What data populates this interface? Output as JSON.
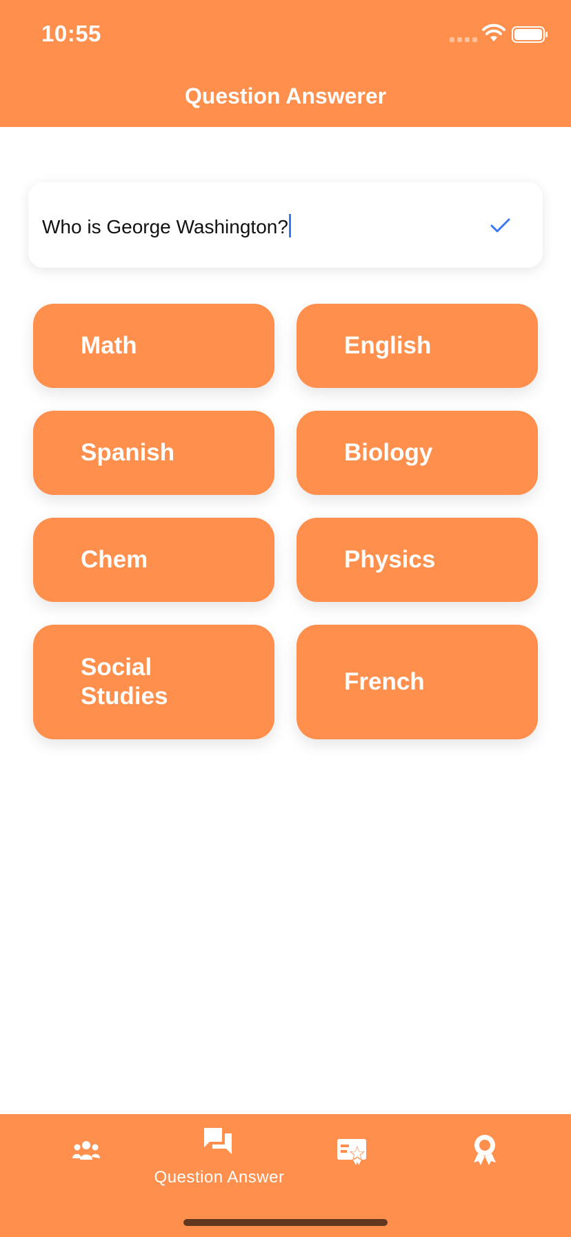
{
  "status_bar": {
    "time": "10:55"
  },
  "header": {
    "title": "Question Answerer"
  },
  "question_input": {
    "value": "Who is George Washington?"
  },
  "subjects": [
    {
      "label": "Math"
    },
    {
      "label": "English"
    },
    {
      "label": "Spanish"
    },
    {
      "label": "Biology"
    },
    {
      "label": "Chem"
    },
    {
      "label": "Physics"
    },
    {
      "label": "Social\nStudies"
    },
    {
      "label": "French"
    }
  ],
  "tab_bar": {
    "tabs": [
      {
        "icon": "group-icon",
        "label": ""
      },
      {
        "icon": "chat-bubbles-icon",
        "label": "Question Answer",
        "active": true
      },
      {
        "icon": "flashcard-star-icon",
        "label": ""
      },
      {
        "icon": "award-ribbon-icon",
        "label": ""
      }
    ]
  },
  "colors": {
    "accent": "#FF8F4C",
    "caret": "#3478F6",
    "check": "#3478F6"
  }
}
